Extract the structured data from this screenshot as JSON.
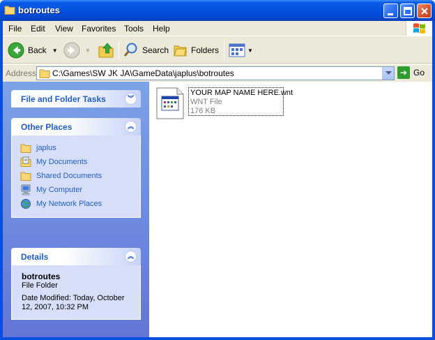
{
  "window": {
    "title": "botroutes"
  },
  "menu": {
    "file": "File",
    "edit": "Edit",
    "view": "View",
    "favorites": "Favorites",
    "tools": "Tools",
    "help": "Help"
  },
  "toolbar": {
    "back_label": "Back",
    "search_label": "Search",
    "folders_label": "Folders"
  },
  "address": {
    "label": "Address",
    "path": "C:\\Games\\SW JK JA\\GameData\\japlus\\botroutes",
    "go_label": "Go"
  },
  "tasks_panel": {
    "file_folder_tasks_title": "File and Folder Tasks",
    "other_places_title": "Other Places",
    "other_places": [
      {
        "label": "japlus",
        "icon": "folder-icon"
      },
      {
        "label": "My Documents",
        "icon": "my-documents-icon"
      },
      {
        "label": "Shared Documents",
        "icon": "folder-icon"
      },
      {
        "label": "My Computer",
        "icon": "my-computer-icon"
      },
      {
        "label": "My Network Places",
        "icon": "network-places-icon"
      }
    ],
    "details_title": "Details",
    "details": {
      "name": "botroutes",
      "type": "File Folder",
      "modified": "Date Modified: Today, October 12, 2007, 10:32 PM"
    }
  },
  "files": [
    {
      "name": "YOUR MAP NAME HERE.wnt",
      "type": "WNT File",
      "size": "176 KB"
    }
  ],
  "colors": {
    "titlebar": "#0452de",
    "taskpane_link": "#215dc6",
    "frame": "#ece9d8"
  }
}
